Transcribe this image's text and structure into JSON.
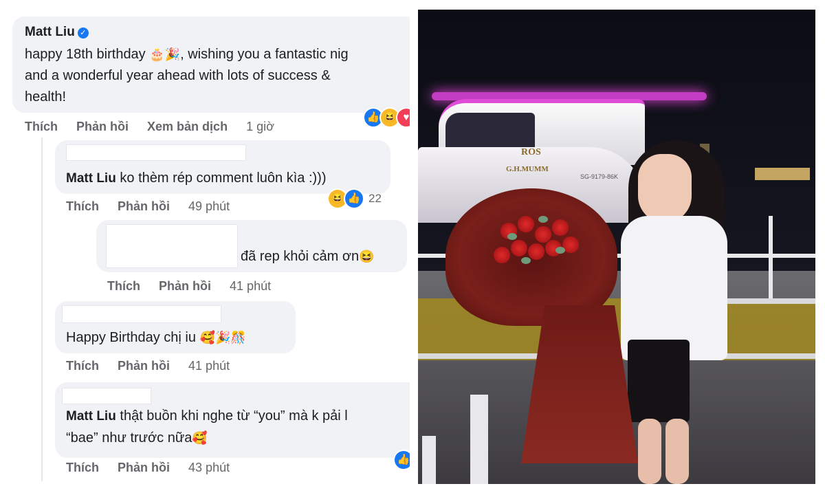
{
  "comments": [
    {
      "author": "Matt Liu",
      "lines": [
        "happy 18th birthday",
        ", wishing you a fantastic nig",
        "and a wonderful year ahead with lots of success &",
        "health!"
      ],
      "actions": {
        "like": "Thích",
        "reply": "Phản hồi",
        "translate": "Xem bản dịch",
        "time": "1 giờ"
      }
    },
    {
      "author": "Matt Liu",
      "text": "ko thèm rép comment luôn kìa :)))",
      "actions": {
        "like": "Thích",
        "reply": "Phản hồi",
        "time": "49 phút"
      },
      "reaction_count": "22"
    },
    {
      "text": "đã rep khỏi cảm ơn",
      "actions": {
        "like": "Thích",
        "reply": "Phản hồi",
        "time": "41 phút"
      }
    },
    {
      "text": "Happy Birthday chị iu",
      "actions": {
        "like": "Thích",
        "reply": "Phản hồi",
        "time": "41 phút"
      }
    },
    {
      "author": "Matt Liu",
      "lines": [
        "thật buồn khi nghe từ “you” mà k pải l",
        "“bae” như trước nữa"
      ],
      "actions": {
        "like": "Thích",
        "reply": "Phản hồi",
        "time": "43 phút"
      }
    }
  ],
  "photo": {
    "boat_name": "ROS",
    "boat_sponsor": "G.H.MUMM",
    "boat_registration": "SG-9179-86K"
  },
  "colors": {
    "bubble": "#f0f2f5",
    "link_blue": "#1877f2",
    "muted": "#65676b"
  },
  "icons": [
    "verified-badge-icon",
    "like-reaction-icon",
    "haha-reaction-icon",
    "cake-emoji-icon",
    "party-popper-emoji-icon",
    "smiling-hearts-emoji-icon",
    "confetti-emoji-icon"
  ]
}
